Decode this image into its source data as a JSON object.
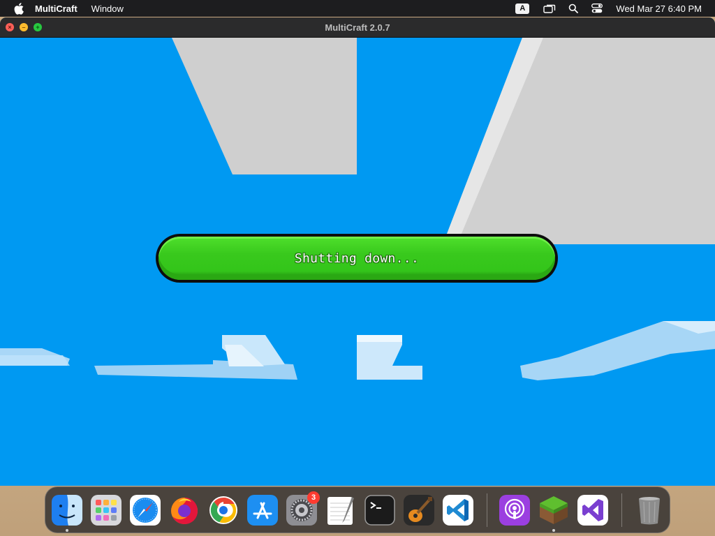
{
  "menubar": {
    "app_name": "MultiCraft",
    "menus": [
      "Window"
    ],
    "input_source": "A",
    "clock": "Wed Mar 27  6:40 PM"
  },
  "window": {
    "title": "MultiCraft 2.0.7"
  },
  "game": {
    "status_text": "Shutting down..."
  },
  "dock": {
    "items": [
      {
        "name": "Finder",
        "icon": "finder-icon",
        "running": true
      },
      {
        "name": "Launchpad",
        "icon": "launchpad-icon"
      },
      {
        "name": "Safari",
        "icon": "safari-icon"
      },
      {
        "name": "Firefox",
        "icon": "firefox-icon"
      },
      {
        "name": "Chrome",
        "icon": "chrome-icon"
      },
      {
        "name": "App Store",
        "icon": "app-store-icon"
      },
      {
        "name": "System Settings",
        "icon": "settings-icon",
        "badge": "3"
      },
      {
        "name": "TextEdit",
        "icon": "textedit-icon"
      },
      {
        "name": "Terminal",
        "icon": "terminal-icon"
      },
      {
        "name": "GarageBand",
        "icon": "garageband-icon"
      },
      {
        "name": "VS Code",
        "icon": "vscode-icon"
      },
      {
        "name": "Podcasts",
        "icon": "podcasts-icon"
      },
      {
        "name": "MultiCraft",
        "icon": "multicraft-icon",
        "running": true
      },
      {
        "name": "Visual Studio",
        "icon": "visual-studio-icon"
      },
      {
        "name": "Trash",
        "icon": "trash-icon"
      }
    ]
  },
  "colors": {
    "sky": "#0099f2",
    "cloud": "#cfcfcf",
    "pill_green": "#39c91d",
    "badge_red": "#ff3b30"
  }
}
